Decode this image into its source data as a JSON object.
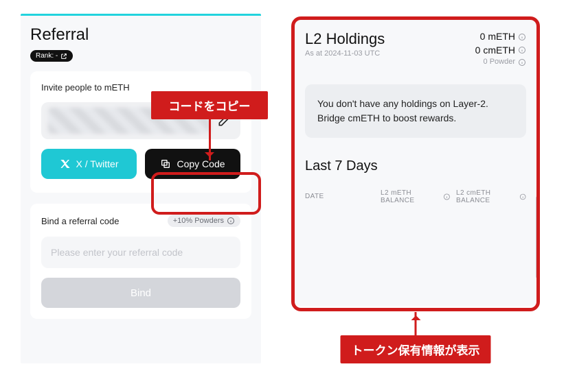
{
  "left": {
    "title": "Referral",
    "rank_label": "Rank: -",
    "invite_label": "Invite people to mETH",
    "twitter_label": "X / Twitter",
    "copy_label": "Copy Code",
    "bind_title": "Bind a referral code",
    "bonus_label": "+10% Powders",
    "input_placeholder": "Please enter your referral code",
    "bind_button": "Bind",
    "callout_text": "コードをコピー"
  },
  "right": {
    "title": "L2 Holdings",
    "as_at": "As at 2024-11-03 UTC",
    "meth_balance": "0 mETH",
    "cmeth_balance": "0 cmETH",
    "powder_balance": "0 Powder",
    "empty_msg": "You don't have any holdings on Layer-2. Bridge cmETH to boost rewards.",
    "last7_title": "Last 7 Days",
    "th_date": "DATE",
    "th_meth": "L2 mETH BALANCE",
    "th_cmeth": "L2 cmETH BALANCE",
    "callout_text": "トークン保有情報が表示"
  }
}
